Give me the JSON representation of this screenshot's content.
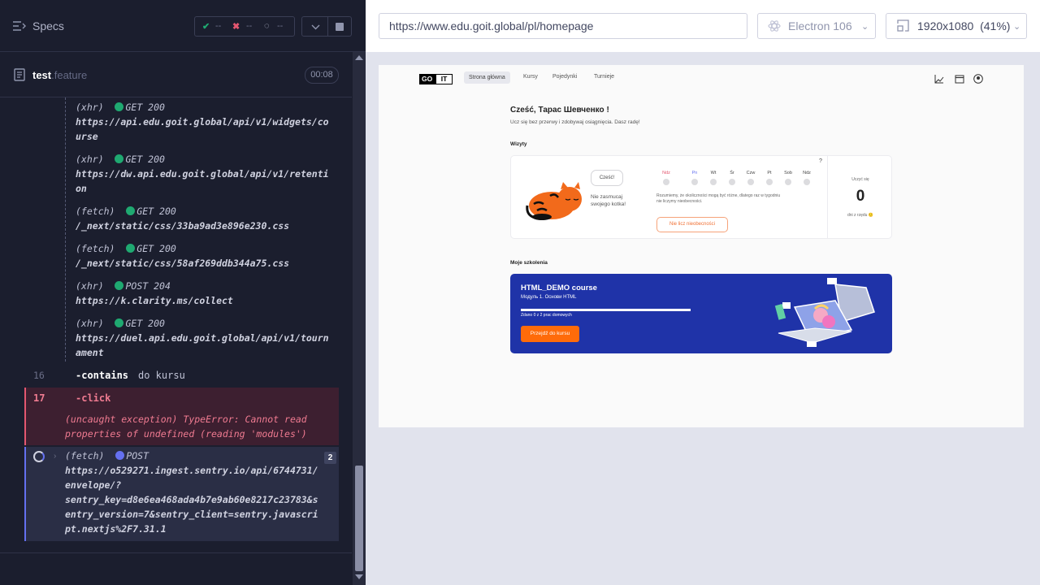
{
  "runner": {
    "specs_label": "Specs",
    "stats": {
      "passed": "--",
      "failed": "--",
      "pending": "--"
    },
    "file": {
      "name": "test",
      "ext": ".feature",
      "timer": "00:08"
    },
    "log": [
      {
        "kind": "(xhr)",
        "method": "GET 200",
        "url_lines": [
          "https://api.edu.goit.global/api/v1/widgets/co",
          "urse"
        ]
      },
      {
        "kind": "(xhr)",
        "method": "GET 200",
        "url_lines": [
          "https://dw.api.edu.goit.global/api/v1/retenti",
          "on"
        ]
      },
      {
        "kind": "(fetch)",
        "method": "GET 200",
        "url_lines": [
          "/_next/static/css/33ba9ad3e896e230.css"
        ]
      },
      {
        "kind": "(fetch)",
        "method": "GET 200",
        "url_lines": [
          "/_next/static/css/58af269ddb344a75.css"
        ]
      },
      {
        "kind": "(xhr)",
        "method": "POST 204",
        "url_lines": [
          "https://k.clarity.ms/collect"
        ]
      },
      {
        "kind": "(xhr)",
        "method": "GET 200",
        "url_lines": [
          "https://duel.api.edu.goit.global/api/v1/tourn",
          "ament"
        ]
      }
    ],
    "contains_cmd": {
      "num": "16",
      "name": "-contains",
      "arg": "do kursu"
    },
    "click_cmd": {
      "num": "17",
      "name": "-click"
    },
    "error": {
      "line1": "(uncaught exception)  TypeError: Cannot read",
      "line2": "properties of undefined (reading 'modules')"
    },
    "pending": {
      "kind": "(fetch)",
      "method": "POST",
      "badge": "2",
      "url_lines": [
        "https://o529271.ingest.sentry.io/api/6744731/",
        "envelope/?",
        "sentry_key=d8e6ea468ada4b7e9ab60e8217c23783&s",
        "entry_version=7&sentry_client=sentry.javascri",
        "pt.nextjs%2F7.31.1"
      ]
    }
  },
  "browser_bar": {
    "url": "https://www.edu.goit.global/pl/homepage",
    "browser": "Electron 106",
    "viewport": "1920x1080",
    "zoom": "(41%)"
  },
  "app": {
    "logo": {
      "go": "GO",
      "it": "IT"
    },
    "nav": [
      "Strona główna",
      "Kursy",
      "Pojedynki",
      "Turnieje"
    ],
    "greeting": "Cześć, Тарас Шевченко !",
    "subtitle": "Ucz się bez przerwy i zdobywaj osiągnięcia. Dasz radę!",
    "visits_title": "Wizyty",
    "bubble": "Cześć!",
    "cat_message": "Nie zasmucaj swojego kotka!",
    "days": [
      "Ndz",
      "Pn",
      "Wt",
      "Śr",
      "Czw",
      "Pt",
      "Sob",
      "Ndz"
    ],
    "explain": "Rozumiemy, że okoliczności mogą być różne, dlatego raz w tygodniu nie liczymy nieobecności.",
    "ignore_button": "Nie licz nieobecności",
    "qmark": "?",
    "count_label": "Uczyć się",
    "count": "0",
    "count_sub": "dni z rzędu 🙂",
    "courses_title": "Moje szkolenia",
    "course": {
      "title": "HTML_DEMO course",
      "module": "Модуль 1. Основи HTML",
      "progress_text": "Zdano 0 z 2 prac domowych",
      "button": "Przejdź do kursu"
    }
  }
}
